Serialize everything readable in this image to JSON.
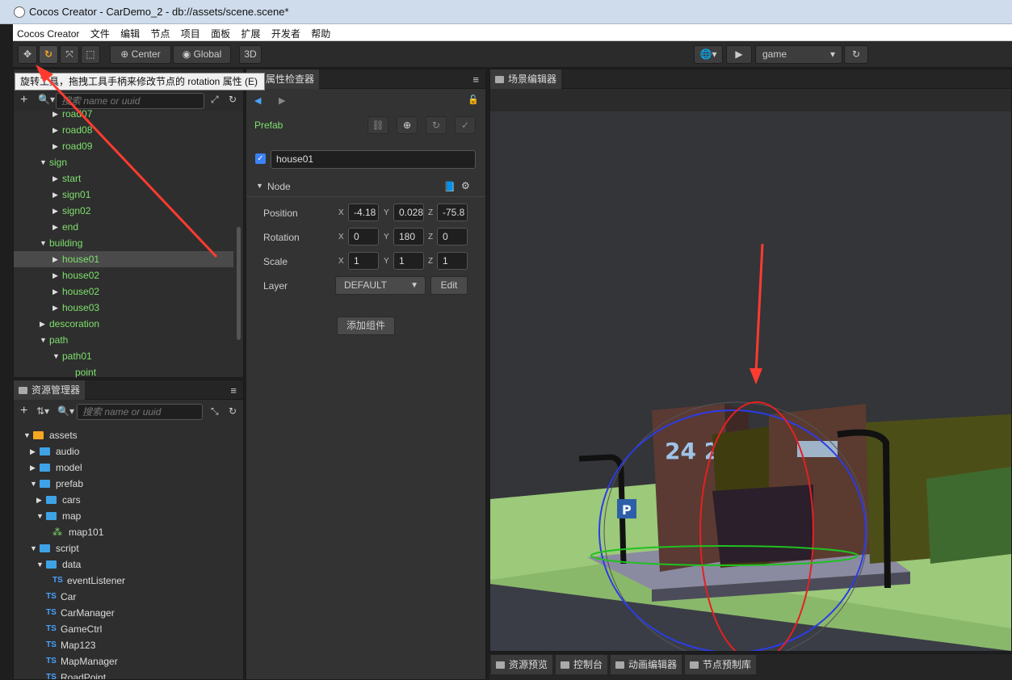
{
  "window": {
    "title": "Cocos Creator - CarDemo_2 - db://assets/scene.scene*"
  },
  "menu": [
    "Cocos Creator",
    "文件",
    "编辑",
    "节点",
    "项目",
    "面板",
    "扩展",
    "开发者",
    "帮助"
  ],
  "toolbar": {
    "center_label": "Center",
    "global_label": "Global",
    "mode_3d": "3D",
    "platform_value": "game",
    "tooltip": "旋转工具，拖拽工具手柄来修改节点的 rotation 属性 (E)"
  },
  "hierarchy": {
    "search_placeholder": "搜索 name or uuid",
    "rows": [
      {
        "label": "road07",
        "depth": 3,
        "arrow": "▶",
        "selected": false
      },
      {
        "label": "road08",
        "depth": 3,
        "arrow": "▶",
        "selected": false
      },
      {
        "label": "road09",
        "depth": 3,
        "arrow": "▶",
        "selected": false
      },
      {
        "label": "sign",
        "depth": 2,
        "arrow": "▼",
        "selected": false
      },
      {
        "label": "start",
        "depth": 3,
        "arrow": "▶",
        "selected": false
      },
      {
        "label": "sign01",
        "depth": 3,
        "arrow": "▶",
        "selected": false
      },
      {
        "label": "sign02",
        "depth": 3,
        "arrow": "▶",
        "selected": false
      },
      {
        "label": "end",
        "depth": 3,
        "arrow": "▶",
        "selected": false
      },
      {
        "label": "building",
        "depth": 2,
        "arrow": "▼",
        "selected": false
      },
      {
        "label": "house01",
        "depth": 3,
        "arrow": "▶",
        "selected": true
      },
      {
        "label": "house02",
        "depth": 3,
        "arrow": "▶",
        "selected": false
      },
      {
        "label": "house02",
        "depth": 3,
        "arrow": "▶",
        "selected": false
      },
      {
        "label": "house03",
        "depth": 3,
        "arrow": "▶",
        "selected": false
      },
      {
        "label": "descoration",
        "depth": 2,
        "arrow": "▶",
        "selected": false
      },
      {
        "label": "path",
        "depth": 2,
        "arrow": "▼",
        "selected": false
      },
      {
        "label": "path01",
        "depth": 3,
        "arrow": "▼",
        "selected": false
      },
      {
        "label": "point",
        "depth": 4,
        "arrow": "",
        "selected": false
      }
    ]
  },
  "assets": {
    "tab_label": "资源管理器",
    "search_placeholder": "搜索 name or uuid",
    "rows": [
      {
        "label": "assets",
        "depth": 0,
        "arrow": "▼",
        "kind": "db"
      },
      {
        "label": "audio",
        "depth": 1,
        "arrow": "▶",
        "kind": "folder"
      },
      {
        "label": "model",
        "depth": 1,
        "arrow": "▶",
        "kind": "folder"
      },
      {
        "label": "prefab",
        "depth": 1,
        "arrow": "▼",
        "kind": "folder"
      },
      {
        "label": "cars",
        "depth": 2,
        "arrow": "▶",
        "kind": "folder"
      },
      {
        "label": "map",
        "depth": 2,
        "arrow": "▼",
        "kind": "folder"
      },
      {
        "label": "map101",
        "depth": 3,
        "arrow": "",
        "kind": "prefab"
      },
      {
        "label": "script",
        "depth": 1,
        "arrow": "▼",
        "kind": "folder"
      },
      {
        "label": "data",
        "depth": 2,
        "arrow": "▼",
        "kind": "folder"
      },
      {
        "label": "eventListener",
        "depth": 3,
        "arrow": "",
        "kind": "ts"
      },
      {
        "label": "Car",
        "depth": 2,
        "arrow": "",
        "kind": "ts"
      },
      {
        "label": "CarManager",
        "depth": 2,
        "arrow": "",
        "kind": "ts"
      },
      {
        "label": "GameCtrl",
        "depth": 2,
        "arrow": "",
        "kind": "ts"
      },
      {
        "label": "Map123",
        "depth": 2,
        "arrow": "",
        "kind": "ts"
      },
      {
        "label": "MapManager",
        "depth": 2,
        "arrow": "",
        "kind": "ts"
      },
      {
        "label": "RoadPoint",
        "depth": 2,
        "arrow": "",
        "kind": "ts"
      }
    ]
  },
  "inspector": {
    "tab_label": "属性检查器",
    "prefab_label": "Prefab",
    "node_name": "house01",
    "node_section": "Node",
    "position": {
      "label": "Position",
      "x": "-4.18",
      "y": "0.028",
      "z": "-75.8"
    },
    "rotation": {
      "label": "Rotation",
      "x": "0",
      "y": "180",
      "z": "0"
    },
    "scale": {
      "label": "Scale",
      "x": "1",
      "y": "1",
      "z": "1"
    },
    "layer": {
      "label": "Layer",
      "value": "DEFAULT",
      "edit": "Edit"
    },
    "add_component": "添加组件",
    "axis_x": "X",
    "axis_y": "Y",
    "axis_z": "Z"
  },
  "scene": {
    "tab_label": "场景编辑器",
    "sign_text": "24 2",
    "parking_text": "P"
  },
  "bottom_tabs": [
    "资源预览",
    "控制台",
    "动画编辑器",
    "节点预制库"
  ],
  "colors": {
    "accent": "#f5a623",
    "node_green": "#7ee06d",
    "arrow_red": "#ff3b30"
  }
}
